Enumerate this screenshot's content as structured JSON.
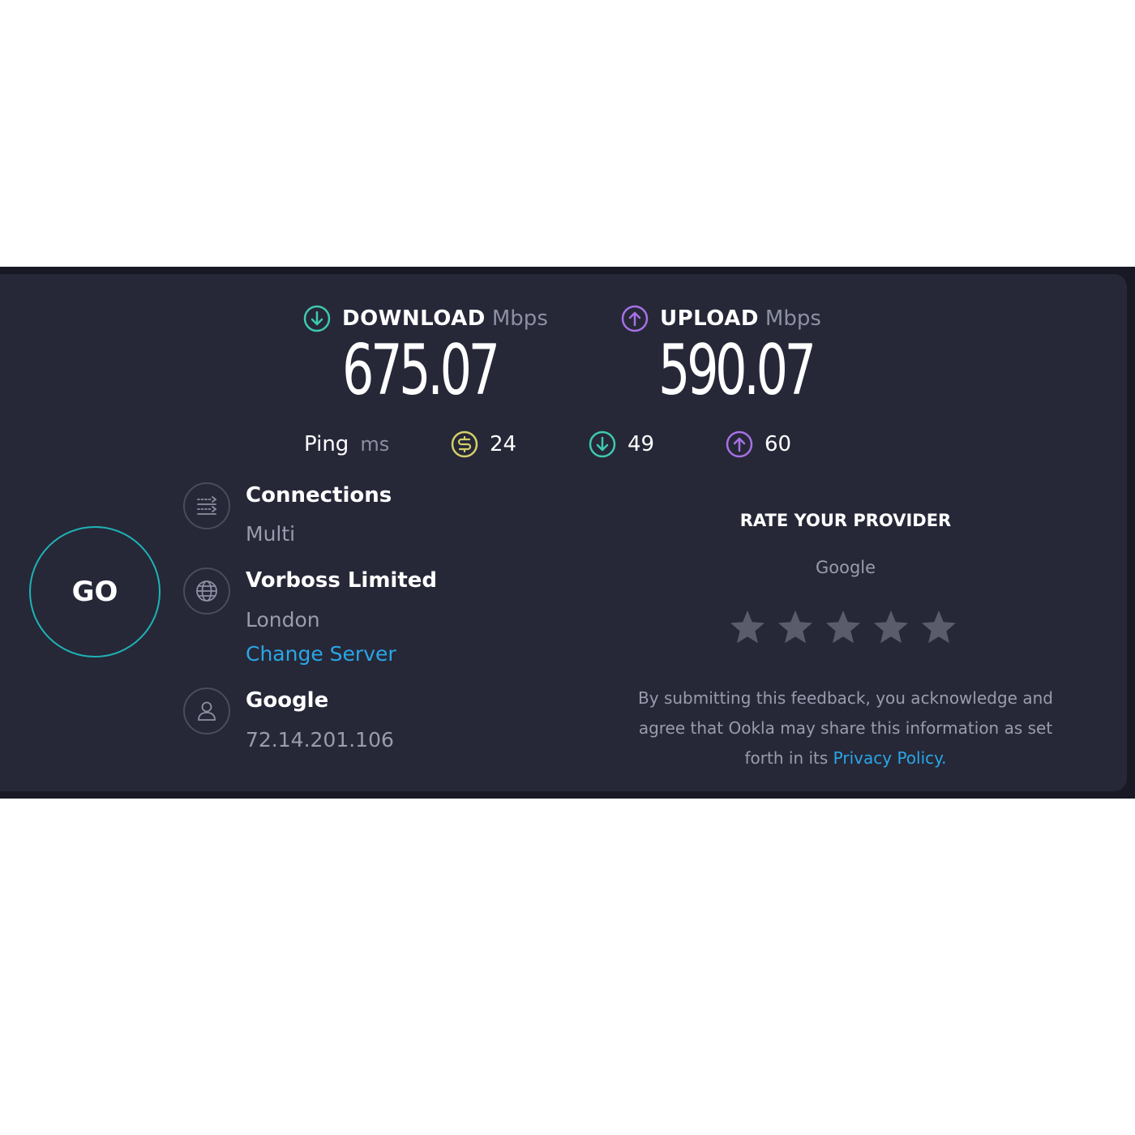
{
  "download": {
    "label": "DOWNLOAD",
    "unit": "Mbps",
    "value": "675.07",
    "icon": "arrow-down-circle-icon",
    "color": "#3ec9b0"
  },
  "upload": {
    "label": "UPLOAD",
    "unit": "Mbps",
    "value": "590.07",
    "icon": "arrow-up-circle-icon",
    "color": "#a770e6"
  },
  "ping": {
    "label": "Ping",
    "unit": "ms",
    "idle": {
      "value": "24",
      "icon": "ping-idle-icon",
      "color": "#d4cf6a"
    },
    "download": {
      "value": "49",
      "icon": "arrow-down-circle-icon",
      "color": "#3ec9b0"
    },
    "upload": {
      "value": "60",
      "icon": "arrow-up-circle-icon",
      "color": "#a770e6"
    }
  },
  "go_button": {
    "label": "GO",
    "color": "#1fb3b5"
  },
  "connections": {
    "title": "Connections",
    "value": "Multi",
    "icon": "connections-icon"
  },
  "server": {
    "title": "Vorboss Limited",
    "location": "London",
    "change_label": "Change Server",
    "icon": "globe-icon"
  },
  "provider": {
    "title": "Google",
    "ip": "72.14.201.106",
    "icon": "user-icon"
  },
  "rating": {
    "title": "RATE YOUR PROVIDER",
    "provider": "Google",
    "stars": 5,
    "star_icon": "star-icon",
    "disclaimer_line1": "By submitting this feedback, you acknowledge and",
    "disclaimer_line2": "agree that Ookla may share this information as set",
    "disclaimer_prefix": "forth in its",
    "privacy_link": "Privacy Policy",
    "disclaimer_suffix": "."
  },
  "colors": {
    "background": "#262838",
    "frame": "#191926",
    "link": "#2aa6e6",
    "muted": "#9a9cad",
    "star": "#5a5c6c"
  }
}
